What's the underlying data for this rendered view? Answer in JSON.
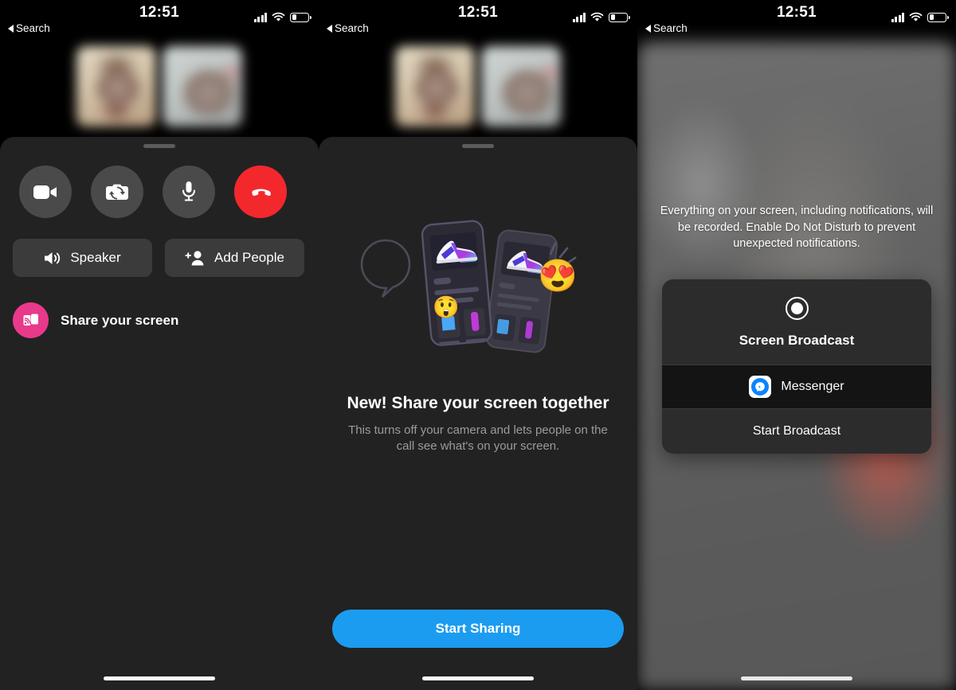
{
  "status_bar": {
    "time": "12:51",
    "back_label": "Search",
    "signal_icon": "cellular-signal-icon",
    "wifi_icon": "wifi-icon",
    "battery_icon": "battery-low-icon"
  },
  "panel_call": {
    "thumbnails": [
      {
        "name": "participant-video-1"
      },
      {
        "name": "participant-video-2"
      }
    ],
    "controls": [
      {
        "icon": "video-camera-icon",
        "name": "toggle-video-button"
      },
      {
        "icon": "flip-camera-icon",
        "name": "flip-camera-button"
      },
      {
        "icon": "microphone-icon",
        "name": "toggle-mic-button"
      },
      {
        "icon": "end-call-icon",
        "name": "end-call-button"
      }
    ],
    "speaker_label": "Speaker",
    "add_people_label": "Add People",
    "share_screen_label": "Share your screen"
  },
  "panel_promo": {
    "title": "New! Share your screen together",
    "subtitle": "This turns off your camera and lets people on the call see what's on your screen.",
    "cta_label": "Start Sharing",
    "illustration": {
      "name": "share-screen-illustration",
      "emoji_left": "😲",
      "emoji_right": "😍"
    }
  },
  "panel_broadcast": {
    "warning": "Everything on your screen, including notifications, will be recorded. Enable Do Not Disturb to prevent unexpected notifications.",
    "dialog_title": "Screen Broadcast",
    "app_option": "Messenger",
    "start_label": "Start Broadcast"
  },
  "colors": {
    "accent_blue": "#1c9cf0",
    "end_call_red": "#f3282d",
    "share_pink": "#e8398b",
    "messenger_blue": "#0a84ff",
    "sheet_bg": "#222222"
  }
}
